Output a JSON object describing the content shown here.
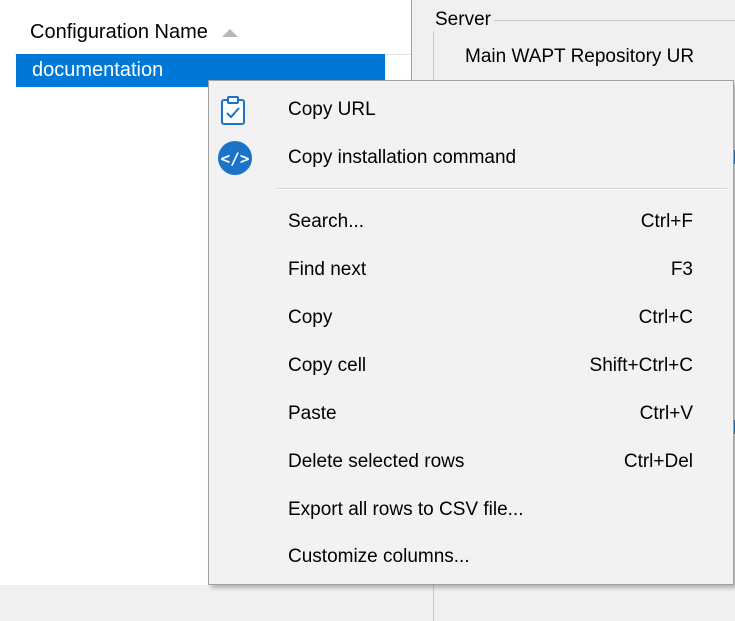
{
  "grid": {
    "column_header": "Configuration Name",
    "rows": [
      {
        "name": "documentation"
      }
    ]
  },
  "server": {
    "group_title": "Server",
    "main_repo_label": "Main WAPT Repository UR"
  },
  "context_menu": {
    "items": [
      {
        "label": "Copy URL",
        "shortcut": "",
        "icon": "clipboard-check-icon"
      },
      {
        "label": "Copy installation command",
        "shortcut": "",
        "icon": "code-icon"
      },
      {
        "label": "Search...",
        "shortcut": "Ctrl+F"
      },
      {
        "label": "Find next",
        "shortcut": "F3"
      },
      {
        "label": "Copy",
        "shortcut": "Ctrl+C"
      },
      {
        "label": "Copy cell",
        "shortcut": "Shift+Ctrl+C"
      },
      {
        "label": "Paste",
        "shortcut": "Ctrl+V"
      },
      {
        "label": "Delete selected rows",
        "shortcut": "Ctrl+Del"
      },
      {
        "label": "Export all rows to CSV file...",
        "shortcut": ""
      },
      {
        "label": "Customize columns...",
        "shortcut": ""
      }
    ],
    "code_icon_glyph": "</>"
  },
  "colors": {
    "selection": "#0078d7",
    "menu_background": "#f2f2f2",
    "icon_blue": "#1a73c9"
  }
}
